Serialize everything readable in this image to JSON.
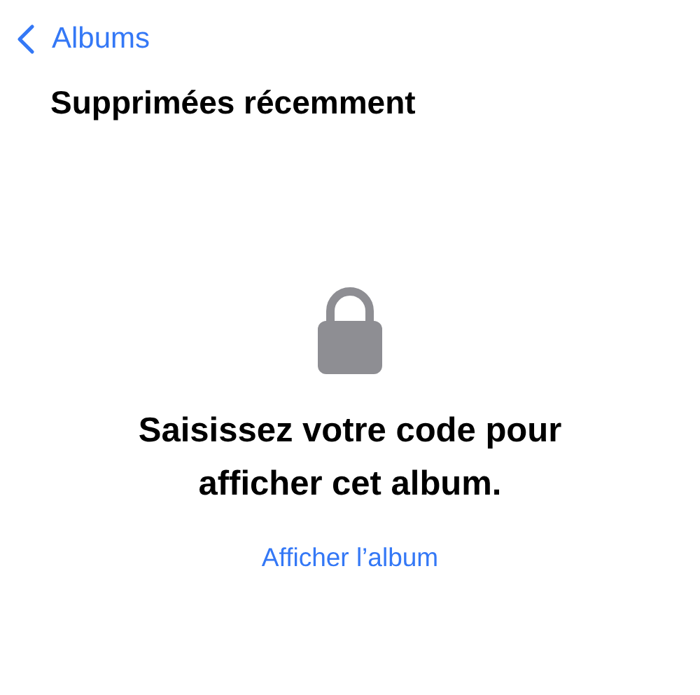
{
  "nav": {
    "back_label": "Albums"
  },
  "title": "Supprimées récemment",
  "message": "Saisissez votre code pour afficher cet album.",
  "action": "Afficher l’album"
}
